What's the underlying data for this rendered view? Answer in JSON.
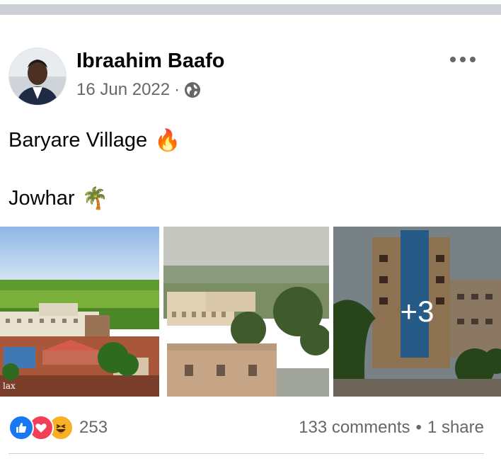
{
  "post": {
    "author": "Ibraahim Baafo",
    "date": "16 Jun 2022",
    "separator": "·",
    "privacy_icon": "globe-icon",
    "menu_icon": "more-dots-icon",
    "text_line1": "Baryare Village",
    "text_line1_emoji": "🔥",
    "text_line2": "Jowhar",
    "text_line2_emoji": "🌴"
  },
  "photos": {
    "more_count": "+3",
    "watermark": "lax"
  },
  "reactions": {
    "icons": [
      "like-icon",
      "love-icon",
      "haha-icon"
    ],
    "count": "253"
  },
  "stats": {
    "comments": "133 comments",
    "dot": "•",
    "shares": "1 share"
  },
  "colors": {
    "like": "#1877f2",
    "love": "#f33e58",
    "haha": "#f7b125",
    "secondary_text": "#65676b"
  }
}
